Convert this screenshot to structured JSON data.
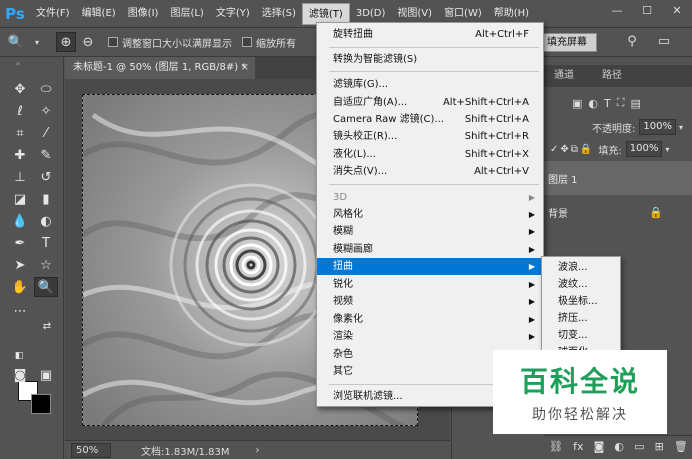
{
  "app": {
    "logo": "Ps"
  },
  "menubar": {
    "items": [
      "文件(F)",
      "编辑(E)",
      "图像(I)",
      "图层(L)",
      "文字(Y)",
      "选择(S)",
      "滤镜(T)",
      "3D(D)",
      "视图(V)",
      "窗口(W)",
      "帮助(H)"
    ],
    "active_index": 6
  },
  "window_controls": {
    "minimize": "—",
    "maximize": "☐",
    "close": "✕"
  },
  "options_bar": {
    "resize_windows_label": "调整窗口大小以满屏显示",
    "zoom_all_label": "缩放所有",
    "fill_screen_label": "填充屏幕"
  },
  "document": {
    "tab_title": "未标题-1 @ 50% (图层 1, RGB/8#) *",
    "tab_close": "×",
    "zoom": "50%",
    "doc_info": "文档:1.83M/1.83M",
    "status_arrow": "›"
  },
  "right_panel": {
    "tabs": [
      "通道",
      "路径"
    ],
    "opacity_label": "不透明度:",
    "opacity_value": "100%",
    "fill_label": "填充:",
    "fill_value": "100%",
    "layers": [
      {
        "name": "图层 1",
        "selected": true
      },
      {
        "name": "背景",
        "selected": false,
        "locked": true
      }
    ]
  },
  "filter_menu": {
    "items": [
      {
        "label": "旋转扭曲",
        "shortcut": "Alt+Ctrl+F"
      },
      {
        "sep": true
      },
      {
        "label": "转换为智能滤镜(S)"
      },
      {
        "sep": true
      },
      {
        "label": "滤镜库(G)..."
      },
      {
        "label": "自适应广角(A)...",
        "shortcut": "Alt+Shift+Ctrl+A"
      },
      {
        "label": "Camera Raw 滤镜(C)...",
        "shortcut": "Shift+Ctrl+A"
      },
      {
        "label": "镜头校正(R)...",
        "shortcut": "Shift+Ctrl+R"
      },
      {
        "label": "液化(L)...",
        "shortcut": "Shift+Ctrl+X"
      },
      {
        "label": "消失点(V)...",
        "shortcut": "Alt+Ctrl+V"
      },
      {
        "sep": true
      },
      {
        "label": "3D",
        "submenu": true,
        "dim": true
      },
      {
        "label": "风格化",
        "submenu": true
      },
      {
        "label": "模糊",
        "submenu": true
      },
      {
        "label": "模糊画廊",
        "submenu": true
      },
      {
        "label": "扭曲",
        "submenu": true,
        "highlight": true
      },
      {
        "label": "锐化",
        "submenu": true
      },
      {
        "label": "视频",
        "submenu": true
      },
      {
        "label": "像素化",
        "submenu": true
      },
      {
        "label": "渲染",
        "submenu": true
      },
      {
        "label": "杂色",
        "submenu": true
      },
      {
        "label": "其它",
        "submenu": true
      },
      {
        "sep": true
      },
      {
        "label": "浏览联机滤镜..."
      }
    ]
  },
  "distort_submenu": {
    "items": [
      "波浪...",
      "波纹...",
      "极坐标...",
      "挤压...",
      "切变...",
      "球面化..."
    ]
  },
  "watermark": {
    "main": "百科全说",
    "sub": "助你轻松解决",
    "color": "#1e9f5a"
  },
  "colors": {
    "accent": "#0078d7",
    "ps_blue": "#31a8ff"
  }
}
